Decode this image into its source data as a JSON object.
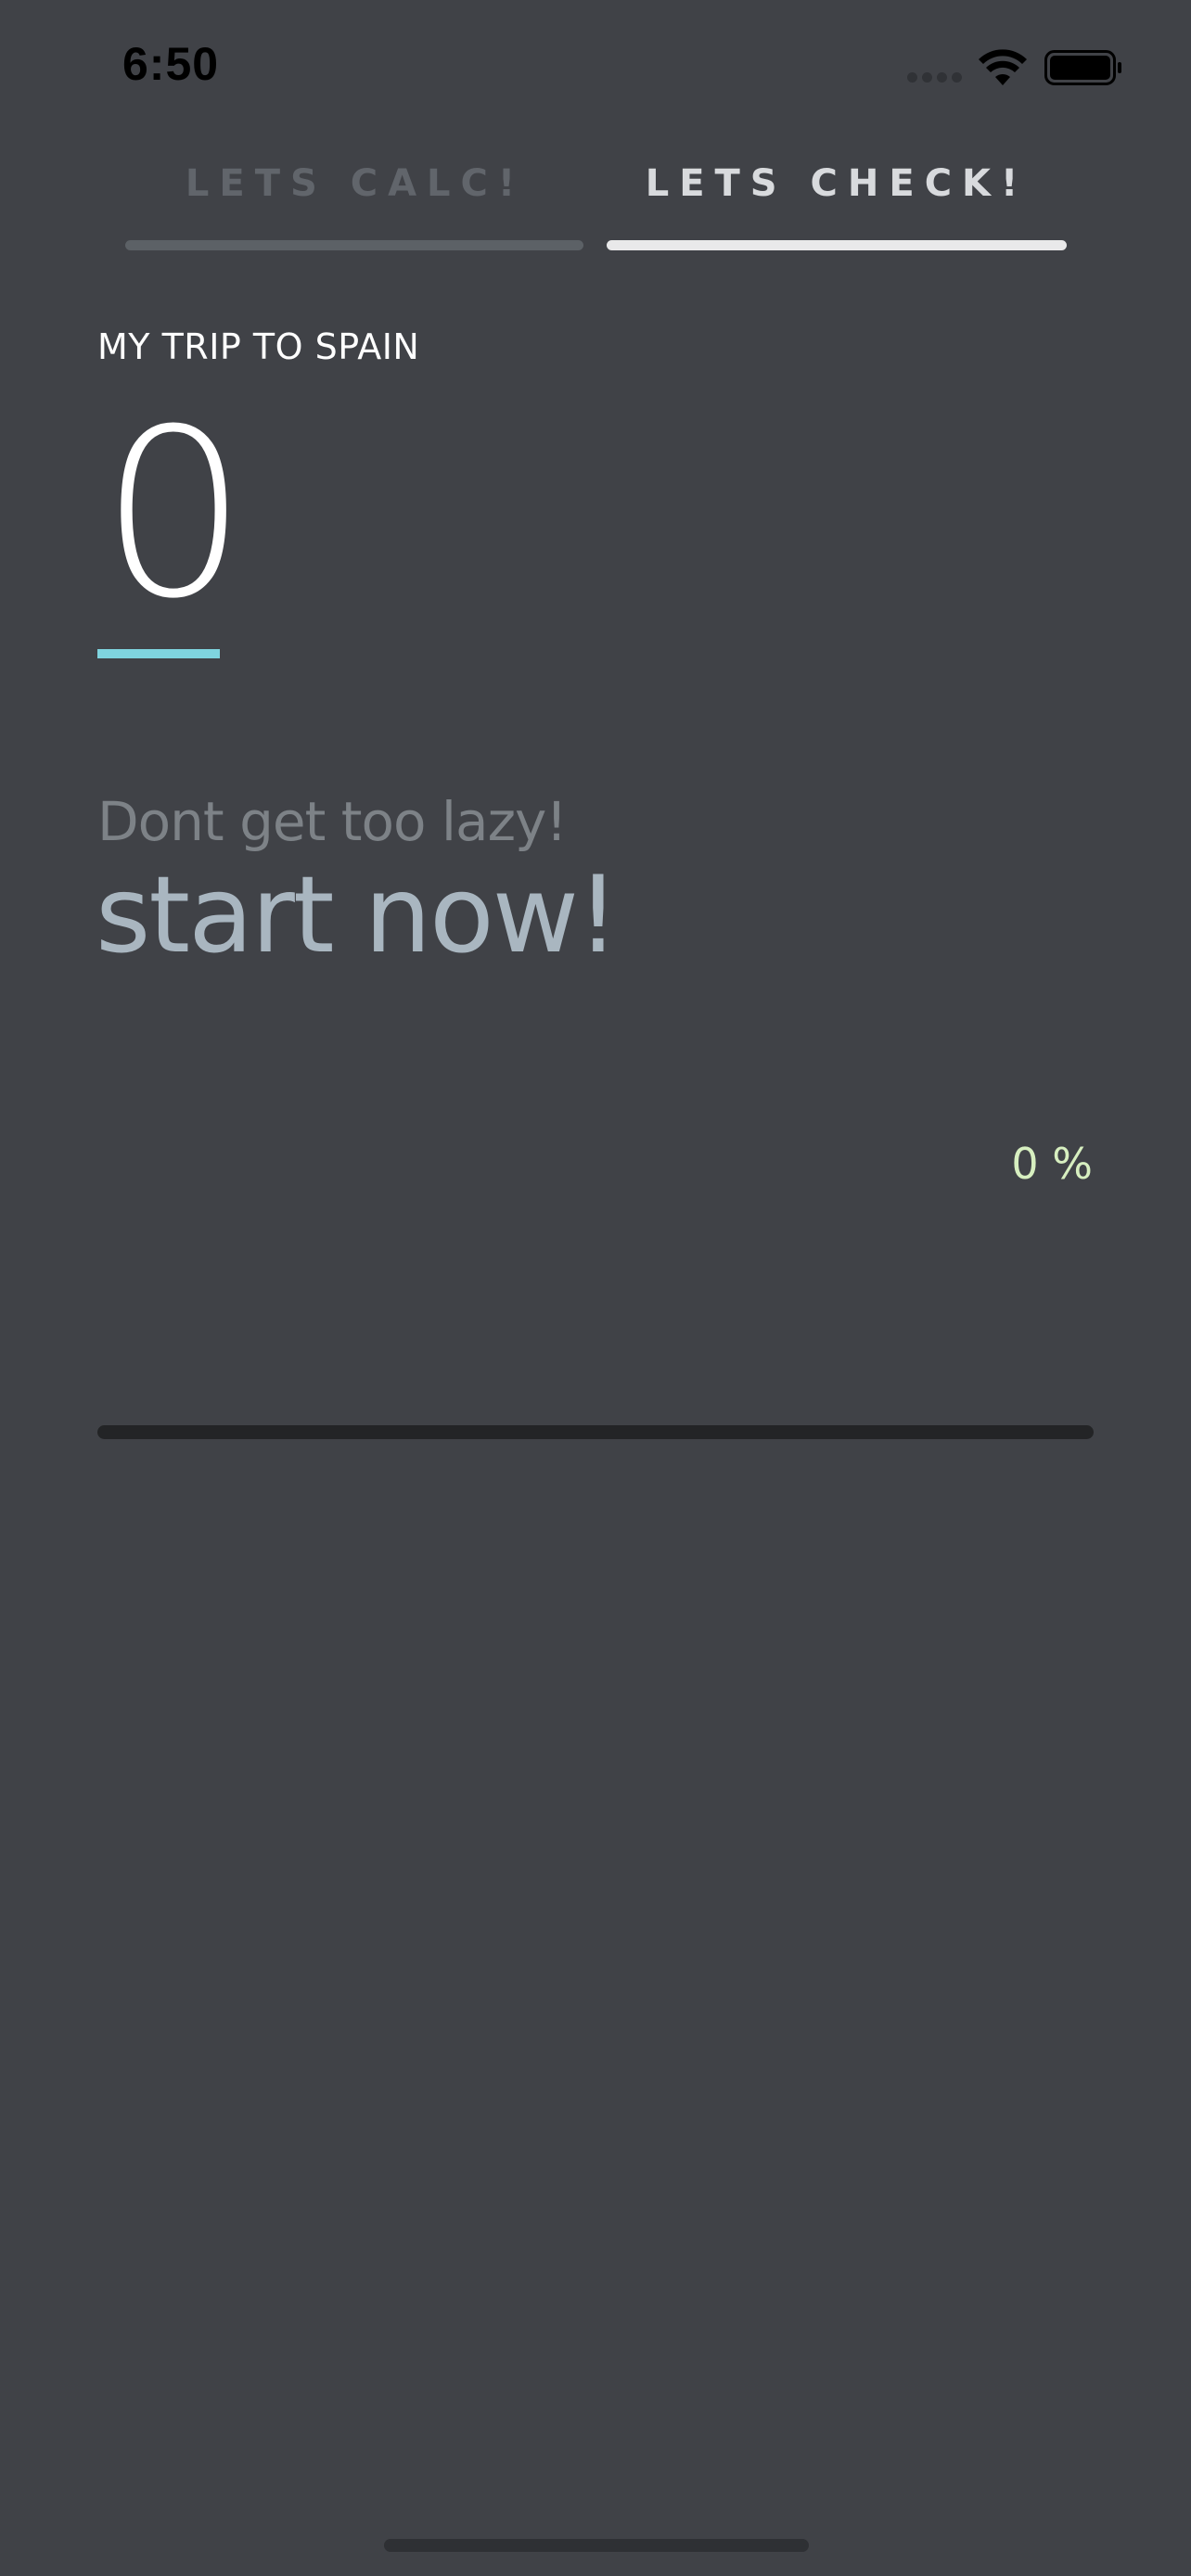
{
  "status_bar": {
    "time": "6:50",
    "signal_icon": "cellular-signal-icon",
    "wifi_icon": "wifi-icon",
    "battery_icon": "battery-icon"
  },
  "tabs": [
    {
      "label": "LETS CALC!",
      "active": false
    },
    {
      "label": "LETS CHECK!",
      "active": true
    }
  ],
  "trip": {
    "title": "MY TRIP TO SPAIN",
    "amount": "0"
  },
  "motivation": {
    "subtitle": "Dont get too lazy!",
    "headline": "start now!"
  },
  "progress": {
    "label": "0 %",
    "fraction": 0
  },
  "colors": {
    "background": "#404247",
    "accent_underline": "#7fd4df",
    "percent_text": "#d7efc0",
    "headline_text": "#a9b6c0"
  }
}
